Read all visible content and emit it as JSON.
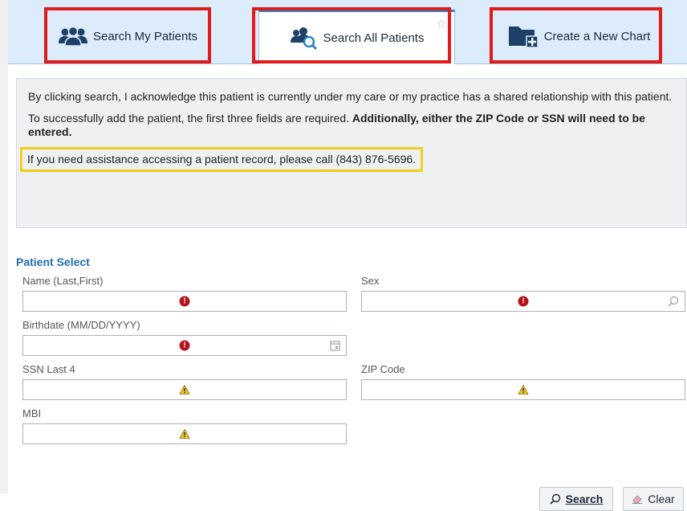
{
  "tabs": {
    "my_patients": "Search My Patients",
    "all_patients": "Search All Patients",
    "new_chart": "Create a New Chart",
    "star": "☆"
  },
  "info": {
    "acknowledge": "By clicking search, I acknowledge this patient is currently under my care or my practice has a shared relationship with this patient.",
    "required_prefix": "To successfully add the patient, the first three fields are required. ",
    "required_bold": "Additionally, either the ZIP Code or SSN will need to be entered.",
    "assistance": "If you need assistance accessing a patient record, please call (843) 876-5696."
  },
  "form": {
    "title": "Patient Select",
    "name_label": "Name (Last,First)",
    "sex_label": "Sex",
    "birthdate_label": "Birthdate (MM/DD/YYYY)",
    "ssn_label": "SSN Last 4",
    "zip_label": "ZIP Code",
    "mbi_label": "MBI",
    "error_glyph": "!",
    "search_prefix": "Search",
    "clear_prefix": "Clear"
  },
  "colors": {
    "highlight_red": "#e11a1a",
    "highlight_yellow": "#f2cf1f",
    "title_blue": "#1e6fb0",
    "error_red": "#b5121b",
    "warning_yellow": "#f3c623"
  }
}
